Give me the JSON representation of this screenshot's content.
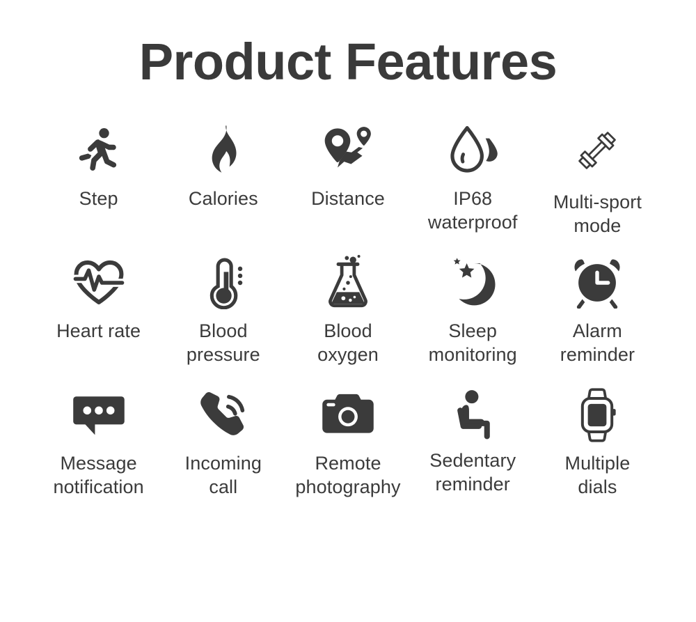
{
  "header": {
    "title": "Product Features"
  },
  "colors": {
    "background": "#ffffff",
    "title_text": "#3a3a3a",
    "label_text": "#3b3b3b",
    "icon_fill": "#3b3b3b"
  },
  "features": {
    "rows": [
      {
        "items": [
          {
            "icon": "running-person-icon",
            "label": "Step"
          },
          {
            "icon": "flame-icon",
            "label": "Calories"
          },
          {
            "icon": "map-pins-route-icon",
            "label": "Distance"
          },
          {
            "icon": "water-drop-icon",
            "label": "IP68\nwaterproof"
          },
          {
            "icon": "dumbbell-icon",
            "label": "Multi-sport\nmode"
          }
        ]
      },
      {
        "items": [
          {
            "icon": "heart-pulse-icon",
            "label": "Heart rate"
          },
          {
            "icon": "thermometer-icon",
            "label": "Blood\npressure"
          },
          {
            "icon": "flask-icon",
            "label": "Blood\noxygen"
          },
          {
            "icon": "moon-stars-icon",
            "label": "Sleep\nmonitoring"
          },
          {
            "icon": "alarm-clock-icon",
            "label": "Alarm\nreminder"
          }
        ]
      },
      {
        "items": [
          {
            "icon": "message-bubble-icon",
            "label": "Message\nnotification"
          },
          {
            "icon": "phone-ringing-icon",
            "label": "Incoming\ncall"
          },
          {
            "icon": "camera-icon",
            "label": "Remote\nphotography"
          },
          {
            "icon": "sitting-person-icon",
            "label": "Sedentary\nreminder"
          },
          {
            "icon": "smartwatch-icon",
            "label": "Multiple\ndials"
          }
        ]
      }
    ]
  }
}
